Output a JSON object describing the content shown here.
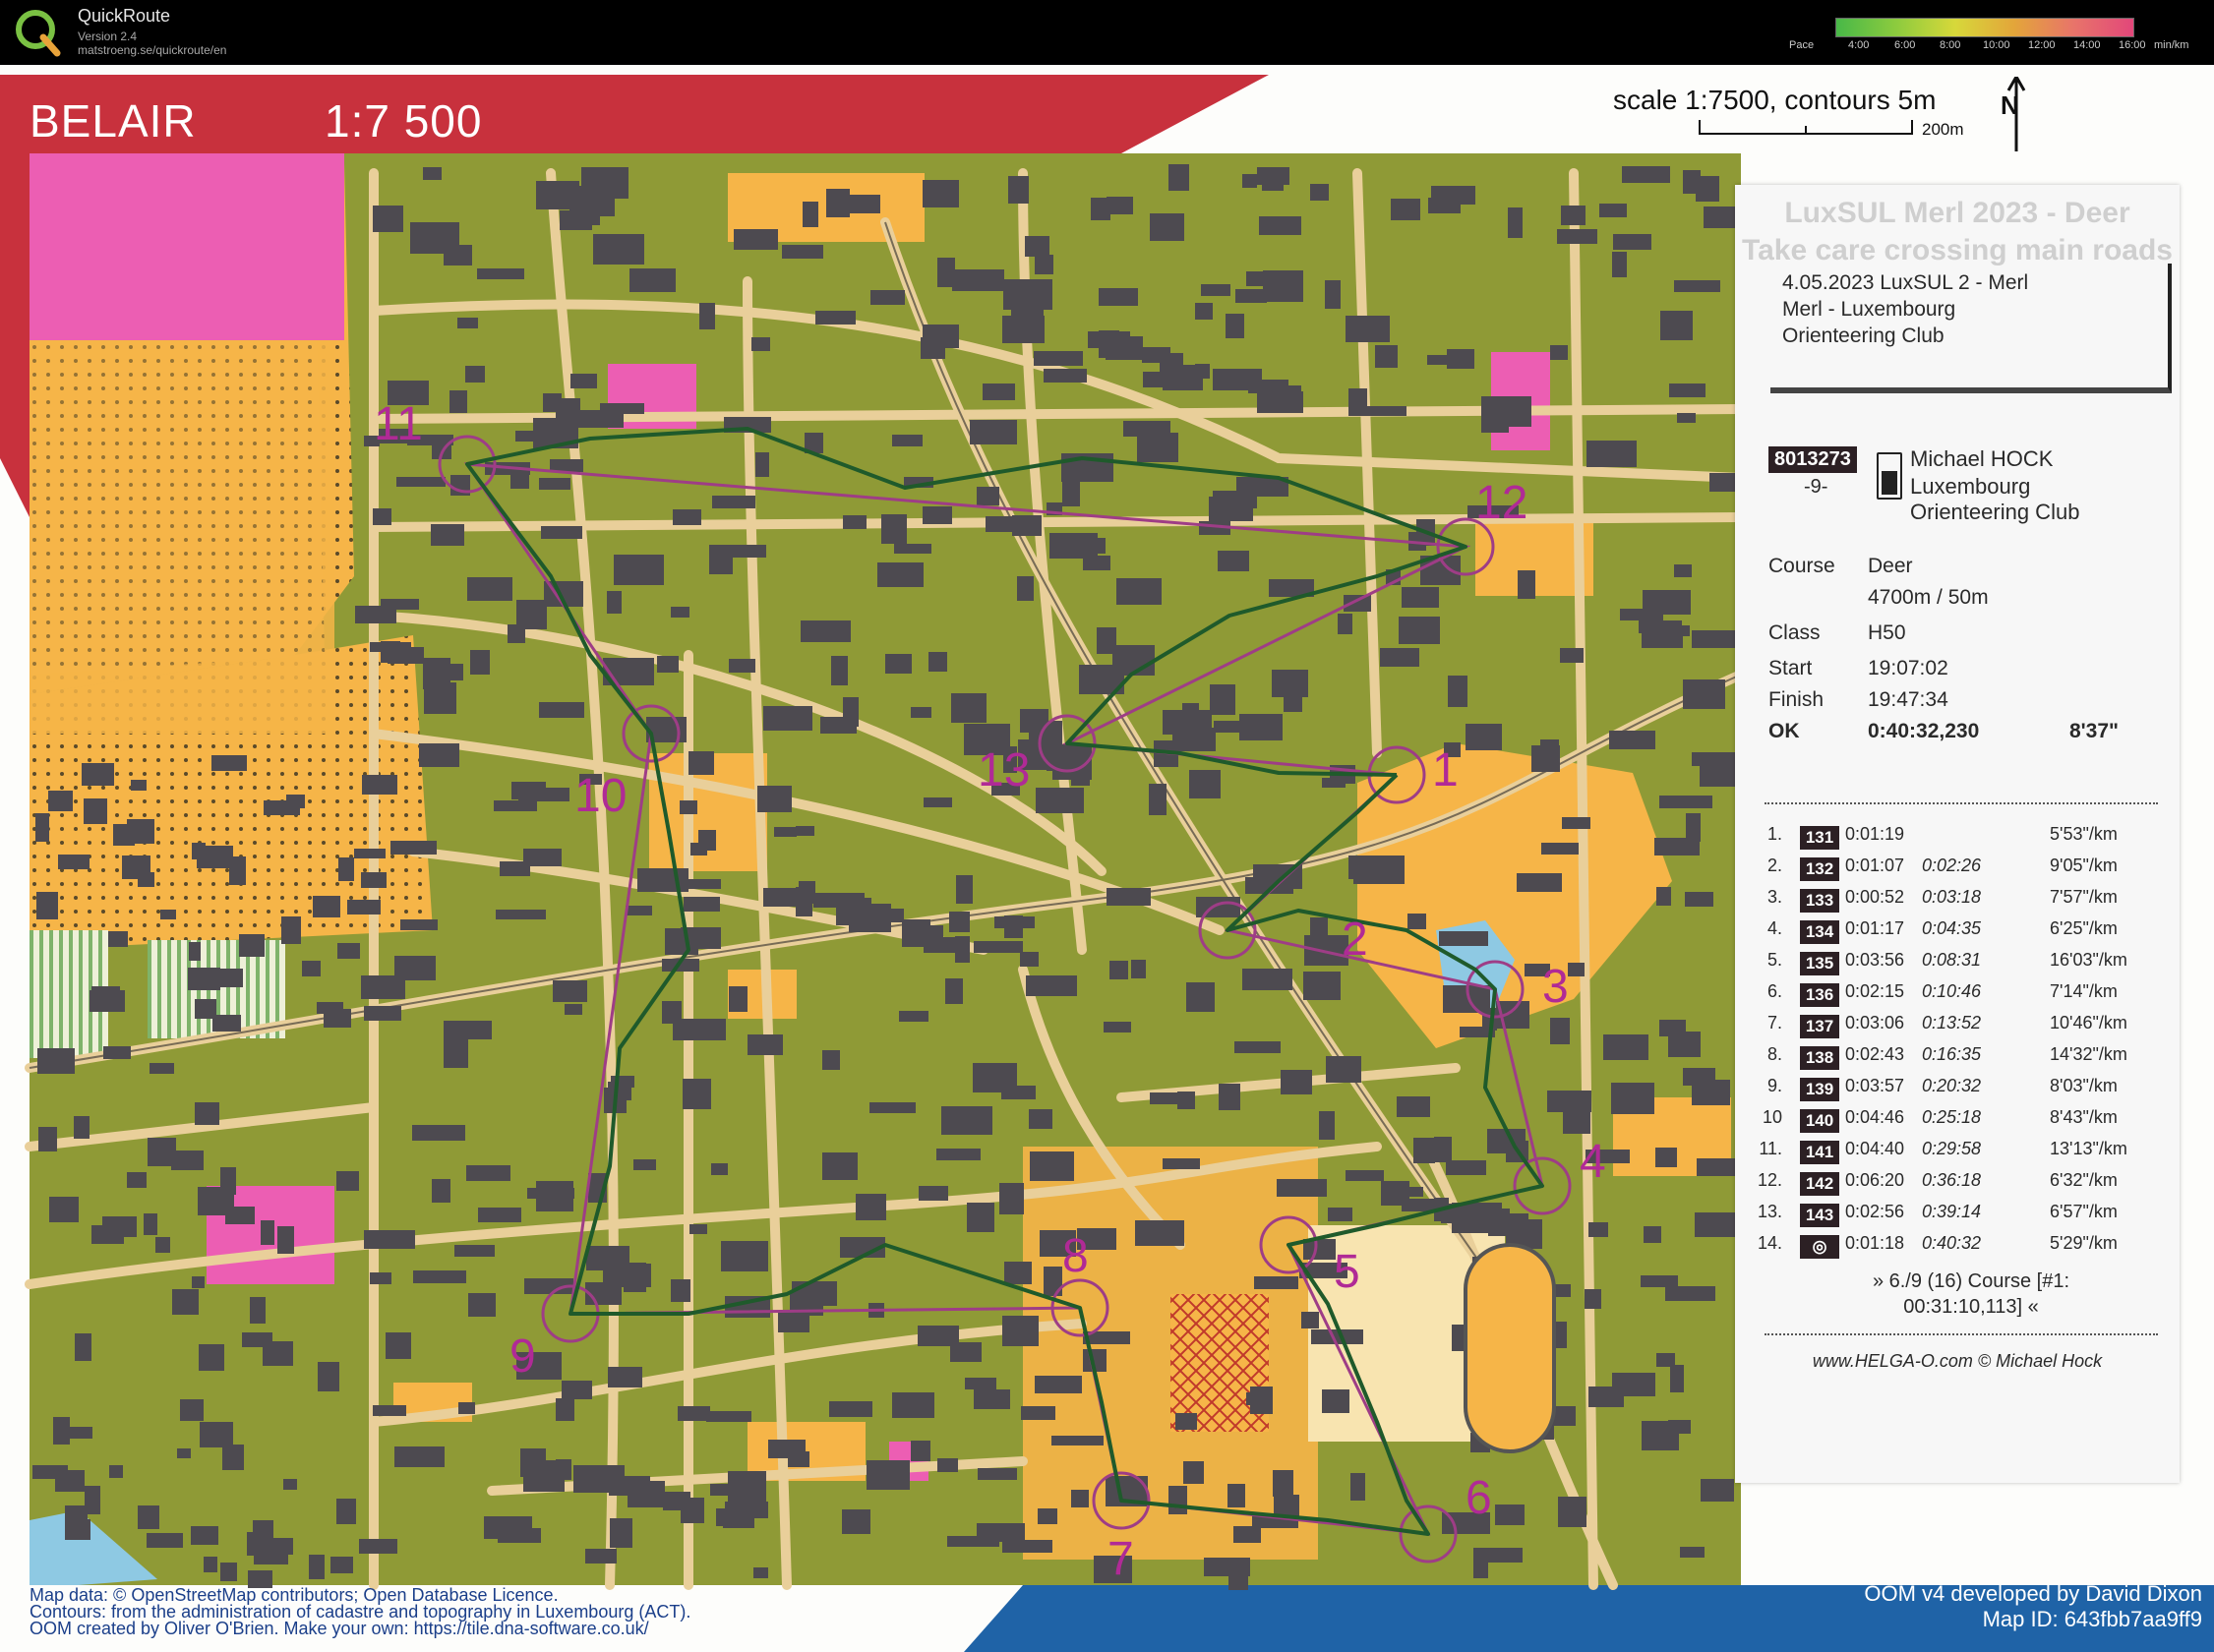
{
  "app": {
    "title": "QuickRoute",
    "version": "Version 2.4",
    "url": "matstroeng.se/quickroute/en",
    "pace_label": "Pace",
    "pace_ticks": [
      "4:00",
      "6:00",
      "8:00",
      "10:00",
      "12:00",
      "14:00",
      "16:00"
    ],
    "pace_unit": "min/km",
    "logo_icon": "quickroute-logo-icon"
  },
  "map": {
    "name": "BELAIR",
    "scale": "1:7 500",
    "scale_text": "scale 1:7500, contours 5m",
    "scale_bar_label": "200m",
    "north": "N",
    "colors": {
      "header_red": "#c8313d",
      "footer_blue": "#1f63a7",
      "forest_green": "#8f9a36",
      "open_yellow": "#f6b548",
      "building": "#4d4a50",
      "road": "#e9cf9a",
      "course_purple": "#9e3d86",
      "route_green": "#1f5a2b",
      "private_pink": "#ec5eb3"
    }
  },
  "receipt": {
    "ghost_lines": [
      "LuxSUL Merl 2023 - Deer",
      "Take care crossing main roads"
    ],
    "event_lines": [
      "4.05.2023   LuxSUL 2 - Merl",
      "Merl - Luxembourg",
      "Orienteering Club"
    ],
    "chip": "8013273",
    "chip_sub": "-9-",
    "runner_name": "Michael HOCK",
    "runner_club": "Luxembourg Orienteering Club",
    "course_label": "Course",
    "course_value": "Deer",
    "course_length": "4700m / 50m",
    "class_label": "Class",
    "class_value": "H50",
    "start_label": "Start",
    "start_value": "19:07:02",
    "finish_label": "Finish",
    "finish_value": "19:47:34",
    "ok_label": "OK",
    "ok_value": "0:40:32,230",
    "ok_pace": "8'37\"",
    "splits": [
      {
        "n": "1.",
        "code": "131",
        "time": "0:01:19",
        "cum": "",
        "pace": "5'53\"/km"
      },
      {
        "n": "2.",
        "code": "132",
        "time": "0:01:07",
        "cum": "0:02:26",
        "pace": "9'05\"/km"
      },
      {
        "n": "3.",
        "code": "133",
        "time": "0:00:52",
        "cum": "0:03:18",
        "pace": "7'57\"/km"
      },
      {
        "n": "4.",
        "code": "134",
        "time": "0:01:17",
        "cum": "0:04:35",
        "pace": "6'25\"/km"
      },
      {
        "n": "5.",
        "code": "135",
        "time": "0:03:56",
        "cum": "0:08:31",
        "pace": "16'03\"/km"
      },
      {
        "n": "6.",
        "code": "136",
        "time": "0:02:15",
        "cum": "0:10:46",
        "pace": "7'14\"/km"
      },
      {
        "n": "7.",
        "code": "137",
        "time": "0:03:06",
        "cum": "0:13:52",
        "pace": "10'46\"/km"
      },
      {
        "n": "8.",
        "code": "138",
        "time": "0:02:43",
        "cum": "0:16:35",
        "pace": "14'32\"/km"
      },
      {
        "n": "9.",
        "code": "139",
        "time": "0:03:57",
        "cum": "0:20:32",
        "pace": "8'03\"/km"
      },
      {
        "n": "10",
        "code": "140",
        "time": "0:04:46",
        "cum": "0:25:18",
        "pace": "8'43\"/km"
      },
      {
        "n": "11.",
        "code": "141",
        "time": "0:04:40",
        "cum": "0:29:58",
        "pace": "13'13\"/km"
      },
      {
        "n": "12.",
        "code": "142",
        "time": "0:06:20",
        "cum": "0:36:18",
        "pace": "6'32\"/km"
      },
      {
        "n": "13.",
        "code": "143",
        "time": "0:02:56",
        "cum": "0:39:14",
        "pace": "6'57\"/km"
      },
      {
        "n": "14.",
        "code": "◎",
        "time": "0:01:18",
        "cum": "0:40:32",
        "pace": "5'29\"/km"
      }
    ],
    "course_note_1": "» 6./9 (16) Course  [#1:",
    "course_note_2": "00:31:10,113]  «",
    "website": "www.HELGA-O.com © Michael Hock"
  },
  "controls": [
    "1",
    "2",
    "3",
    "4",
    "5",
    "6",
    "7",
    "8",
    "9",
    "10",
    "11",
    "12",
    "13"
  ],
  "footer": {
    "left_lines": [
      "Map data: © OpenStreetMap contributors; Open Database Licence.",
      "Contours: from the administration of cadastre and topography in Luxembourg (ACT).",
      "OOM created by Oliver O'Brien. Make your own: https://tile.dna-software.co.uk/"
    ],
    "right_lines": [
      "OOM v4 developed by David Dixon",
      "Map ID: 643fbb7aa9ff9"
    ]
  }
}
